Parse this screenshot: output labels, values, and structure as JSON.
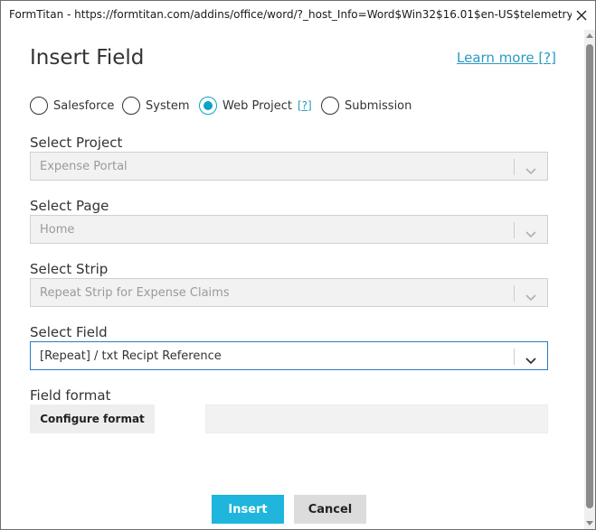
{
  "window": {
    "title": "FormTitan - https://formtitan.com/addins/office/word/?_host_Info=Word$Win32$16.01$en-US$telemetry$isDialog..."
  },
  "dialog": {
    "heading": "Insert Field",
    "learn_more": "Learn more [?]"
  },
  "source_options": [
    {
      "label": "Salesforce",
      "selected": false
    },
    {
      "label": "System",
      "selected": false
    },
    {
      "label": "Web Project",
      "selected": true,
      "help": "[?]"
    },
    {
      "label": "Submission",
      "selected": false
    }
  ],
  "fields": {
    "project": {
      "label": "Select Project",
      "value": "Expense Portal",
      "enabled": false
    },
    "page": {
      "label": "Select Page",
      "value": "Home",
      "enabled": false
    },
    "strip": {
      "label": "Select Strip",
      "value": "Repeat Strip for Expense Claims",
      "enabled": false
    },
    "field": {
      "label": "Select Field",
      "value": "[Repeat] / txt Recipt Reference",
      "enabled": true
    }
  },
  "format": {
    "label": "Field format",
    "configure_button": "Configure format",
    "value": ""
  },
  "actions": {
    "insert": "Insert",
    "cancel": "Cancel"
  },
  "colors": {
    "accent": "#1fb5dc",
    "link": "#2a9ac4",
    "radio_selected": "#0ba3c9",
    "focus_border": "#2a7ac4"
  }
}
